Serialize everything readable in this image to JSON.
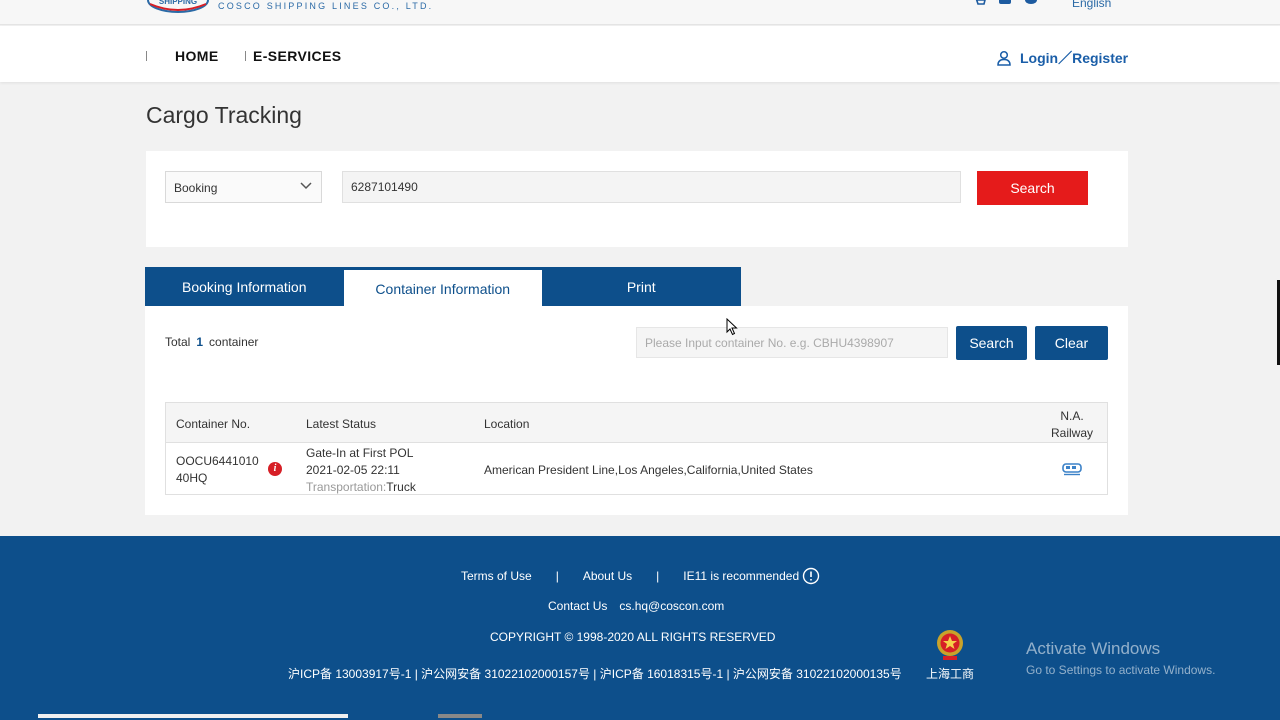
{
  "header": {
    "company_name": "COSCO SHIPPING LINES CO., LTD.",
    "language": "English",
    "nav": [
      "HOME",
      "E-SERVICES"
    ],
    "login_label": "Login／Register"
  },
  "page_title": "Cargo Tracking",
  "search": {
    "type_selected": "Booking",
    "query_value": "6287101490",
    "search_label": "Search"
  },
  "tabs": [
    {
      "label": "Booking Information",
      "active": false
    },
    {
      "label": "Container Information",
      "active": true
    },
    {
      "label": "Print",
      "active": false
    }
  ],
  "results": {
    "total_prefix": "Total",
    "total_count": "1",
    "total_suffix": "container",
    "container_placeholder": "Please Input container No. e.g. CBHU4398907",
    "search_label": "Search",
    "clear_label": "Clear",
    "columns": {
      "container_no": "Container No.",
      "latest_status": "Latest Status",
      "location": "Location",
      "rail_line1": "N.A.",
      "rail_line2": "Railway"
    },
    "rows": [
      {
        "container_no": "OOCU6441010",
        "size_type": "40HQ",
        "status": "Gate-In at First POL",
        "datetime": "2021-02-05 22:11",
        "transport_label": "Transportation:",
        "transport_value": "Truck",
        "location": "American President Line,Los Angeles,California,United States",
        "rail_icon": "train-icon"
      }
    ]
  },
  "footer": {
    "terms": "Terms of Use",
    "about": "About Us",
    "ie_note": "IE11 is recommended",
    "contact_label": "Contact Us",
    "contact_email": "cs.hq@coscon.com",
    "copyright": "COPYRIGHT © 1998-2020 ALL RIGHTS RESERVED",
    "icp": "沪ICP备 13003917号-1 | 沪公网安备 31022102000157号 | 沪ICP备 16018315号-1 | 沪公网安备 31022102000135号",
    "gongshang": "上海工商",
    "sep": "|"
  },
  "watermark": {
    "line1": "Activate Windows",
    "line2": "Go to Settings to activate Windows."
  },
  "colors": {
    "brand_blue": "#0d4f8b",
    "search_red": "#e51b1b",
    "info_red": "#d61f26"
  }
}
